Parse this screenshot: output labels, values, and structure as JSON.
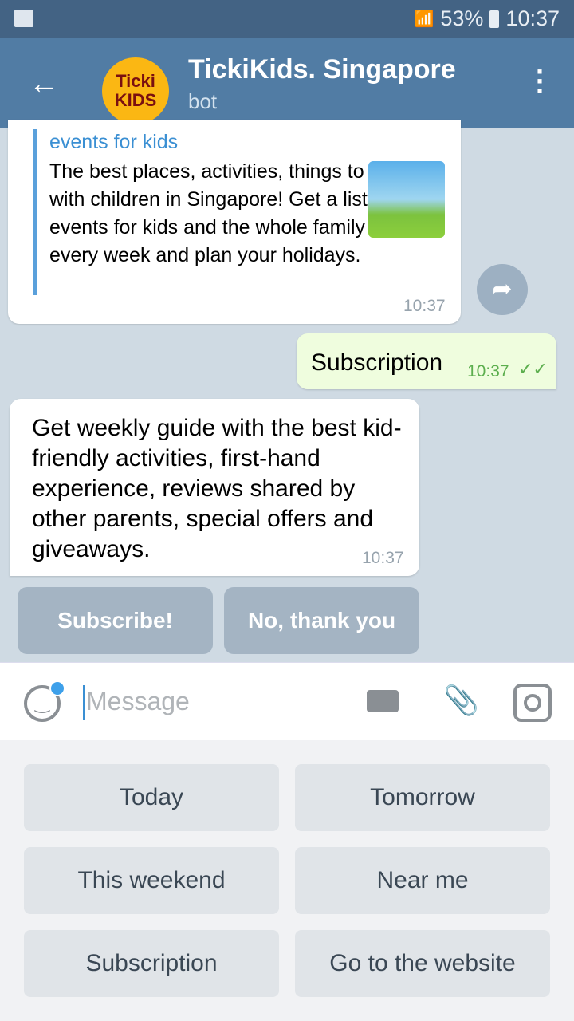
{
  "status": {
    "battery": "53%",
    "time": "10:37"
  },
  "header": {
    "title": "TickiKids. Singapore",
    "subtitle": "bot",
    "avatar_text_1": "Ticki",
    "avatar_text_2": "KIDS"
  },
  "messages": [
    {
      "site": "events for kids",
      "description": "The best places, activities, things to do with children in Singapore! Get a list of events for kids and the whole family every week and plan your holidays.",
      "time": "10:37"
    },
    {
      "text": "Subscription",
      "time": "10:37",
      "status": "read"
    },
    {
      "text": "Get weekly guide with the best kid-friendly activities, first-hand experience, reviews shared by other parents, special offers and giveaways.",
      "time": "10:37"
    }
  ],
  "inline_buttons": [
    "Subscribe!",
    "No, thank you"
  ],
  "input": {
    "placeholder": "Message"
  },
  "keyboard": [
    "Today",
    "Tomorrow",
    "This weekend",
    "Near me",
    "Subscription",
    "Go to the website"
  ]
}
